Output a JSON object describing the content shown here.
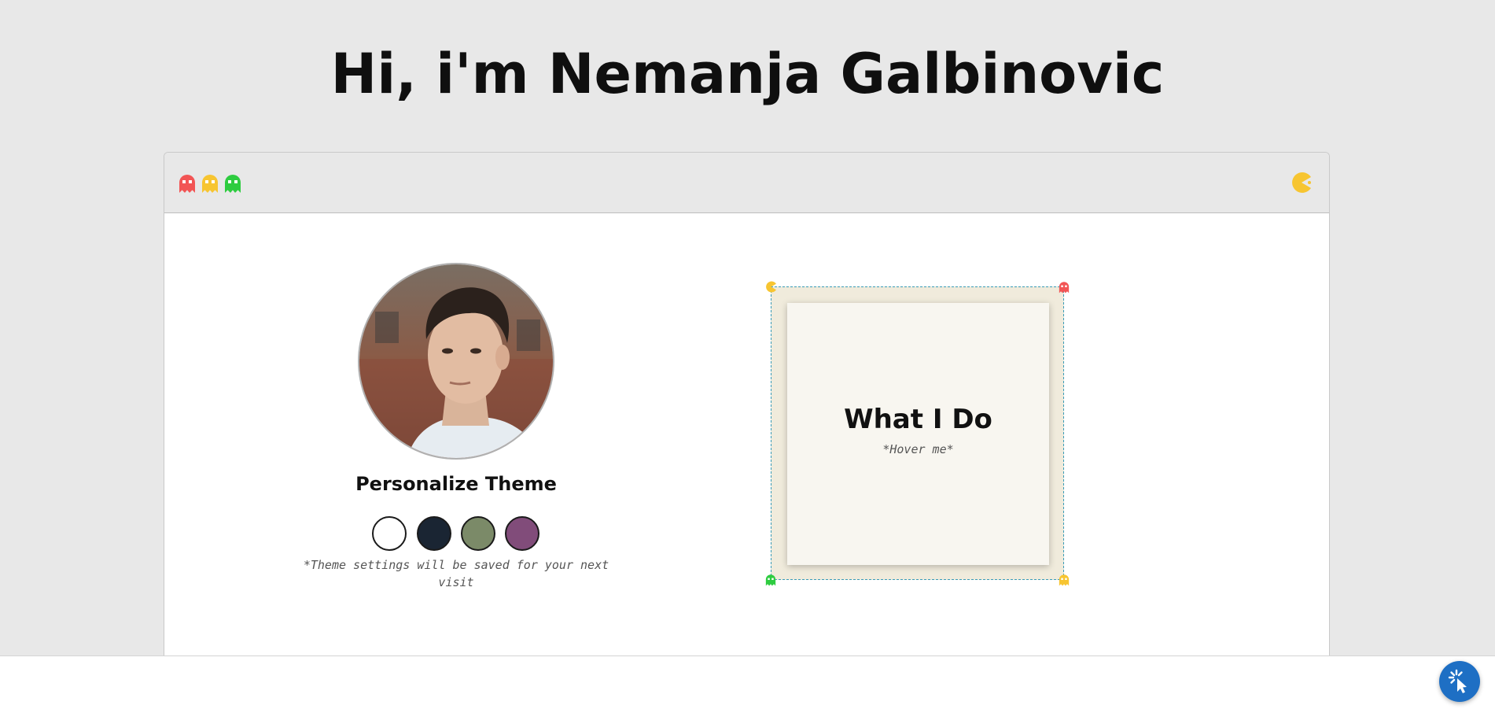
{
  "header": {
    "title": "Hi, i'm Nemanja Galbinovic"
  },
  "window": {
    "ghost_colors": [
      "#f25555",
      "#f7c531",
      "#2ecc40"
    ],
    "pacman_color": "#f7c531"
  },
  "profile": {
    "avatar_alt": "Nemanja Galbinovic"
  },
  "theme": {
    "title": "Personalize Theme",
    "options": [
      {
        "name": "white",
        "color": "#ffffff"
      },
      {
        "name": "navy",
        "color": "#1a2533"
      },
      {
        "name": "olive",
        "color": "#7b8a68"
      },
      {
        "name": "plum",
        "color": "#814c7a"
      }
    ],
    "note": "*Theme settings will be saved for your next visit"
  },
  "card": {
    "title": "What I Do",
    "subtitle": "*Hover me*",
    "corner_icons": [
      "pacman-icon",
      "ghost-icon",
      "ghost-icon",
      "ghost-icon"
    ],
    "frame_color": "#f0ebdc",
    "border_color": "#3a9cb8"
  },
  "fab": {
    "icon": "pointer-click-icon",
    "color": "#1e6fc4"
  }
}
